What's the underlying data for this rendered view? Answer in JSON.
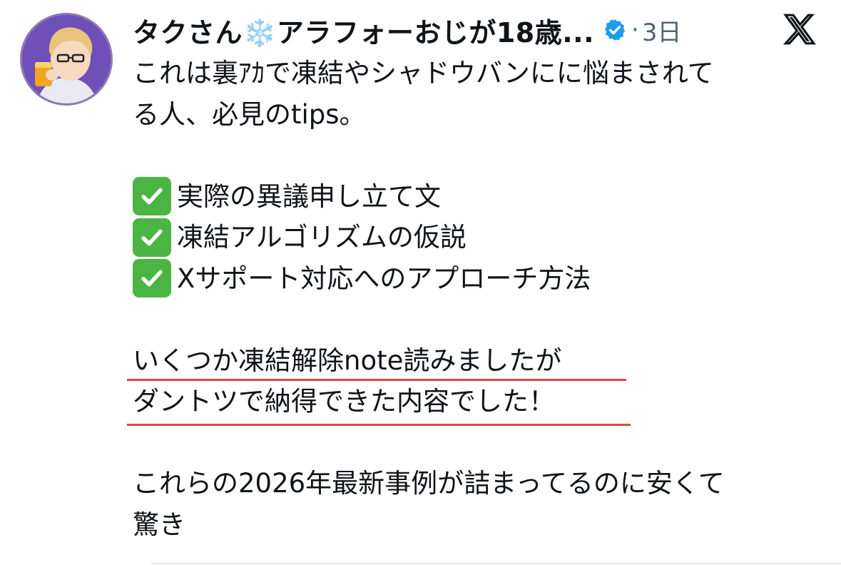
{
  "tweet": {
    "author": {
      "display_name": "タクさん❄️アラフォーおじが18歳...",
      "verified_icon": "verified-badge-icon",
      "avatar": "avatar-illustration"
    },
    "separator": "·",
    "time": "3日",
    "platform_icon": "x-logo-icon",
    "body": {
      "intro_line1": "これは裏ｱｶで凍結やシャドウバンにに悩まされて",
      "intro_line2": "る人、必見のtips。",
      "checklist": [
        {
          "icon": "check-mark-button-icon",
          "text": "実際の異議申し立て文"
        },
        {
          "icon": "check-mark-button-icon",
          "text": "凍結アルゴリズムの仮説"
        },
        {
          "icon": "check-mark-button-icon",
          "text": "Xサポート対応へのアプローチ方法"
        }
      ],
      "highlight_line1": "いくつか凍結解除note読みましたが",
      "highlight_line2": "ダントツで納得できた内容でした！",
      "closing_line1": "これらの2026年最新事例が詰まってるのに安くて",
      "closing_line2": "驚き"
    }
  },
  "colors": {
    "text": "#0f1419",
    "muted": "#536471",
    "verified_blue": "#1d9bf0",
    "check_green": "#4bb543",
    "underline_red": "#e0493b",
    "avatar_bg": "#6f4fb8"
  }
}
